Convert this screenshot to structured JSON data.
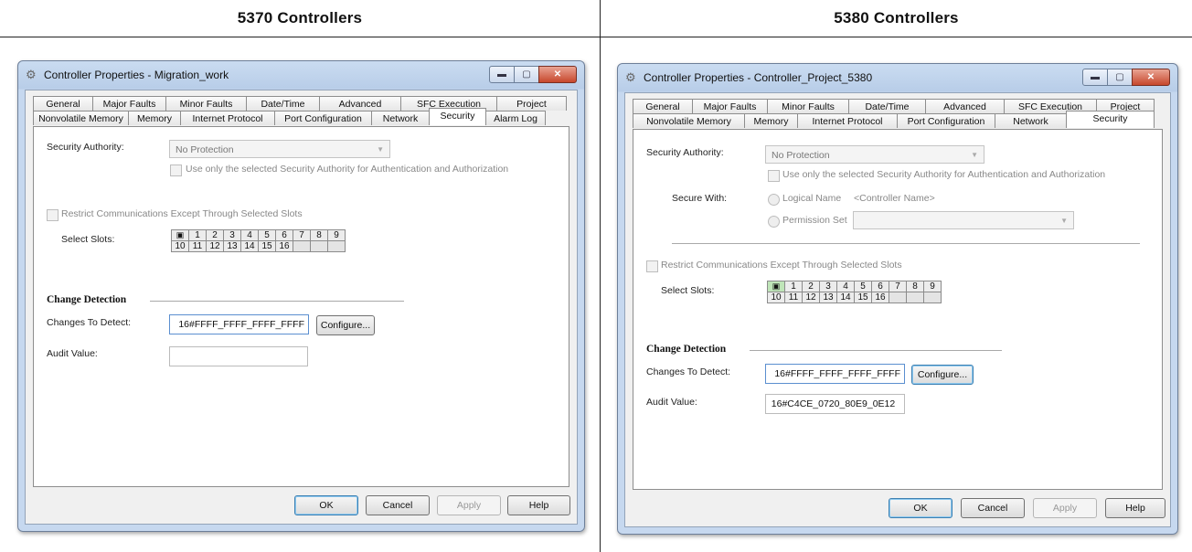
{
  "headers": {
    "left": "5370 Controllers",
    "right": "5380 Controllers"
  },
  "left_dialog": {
    "title": "Controller Properties - Migration_work",
    "tabs_row1": [
      "General",
      "Major Faults",
      "Minor Faults",
      "Date/Time",
      "Advanced",
      "SFC Execution",
      "Project"
    ],
    "tabs_row2": [
      "Nonvolatile Memory",
      "Memory",
      "Internet Protocol",
      "Port Configuration",
      "Network",
      "Security",
      "Alarm Log"
    ],
    "active_tab": "Security",
    "security_authority_label": "Security Authority:",
    "security_authority_value": "No Protection",
    "use_only_label": "Use only the selected Security Authority for Authentication and Authorization",
    "restrict_label": "Restrict Communications Except Through Selected Slots",
    "select_slots_label": "Select Slots:",
    "slots_row1": [
      "1",
      "2",
      "3",
      "4",
      "5",
      "6",
      "7",
      "8",
      "9"
    ],
    "slots_row2": [
      "10",
      "11",
      "12",
      "13",
      "14",
      "15",
      "16",
      "",
      ""
    ],
    "change_detection_label": "Change Detection",
    "changes_to_detect_label": "Changes To Detect:",
    "changes_to_detect_value": "16#FFFF_FFFF_FFFF_FFFF",
    "configure_label": "Configure...",
    "audit_value_label": "Audit Value:",
    "audit_value": "",
    "buttons": {
      "ok": "OK",
      "cancel": "Cancel",
      "apply": "Apply",
      "help": "Help"
    }
  },
  "right_dialog": {
    "title": "Controller Properties - Controller_Project_5380",
    "tabs_row1": [
      "General",
      "Major Faults",
      "Minor Faults",
      "Date/Time",
      "Advanced",
      "SFC Execution",
      "Project"
    ],
    "tabs_row2": [
      "Nonvolatile Memory",
      "Memory",
      "Internet Protocol",
      "Port Configuration",
      "Network",
      "Security"
    ],
    "active_tab": "Security",
    "security_authority_label": "Security Authority:",
    "security_authority_value": "No Protection",
    "use_only_label": "Use only the selected Security Authority for Authentication and Authorization",
    "secure_with_label": "Secure With:",
    "logical_name_label": "Logical Name",
    "logical_name_value": "<Controller Name>",
    "permission_set_label": "Permission Set",
    "restrict_label": "Restrict Communications Except Through Selected Slots",
    "select_slots_label": "Select Slots:",
    "slots_row1": [
      "1",
      "2",
      "3",
      "4",
      "5",
      "6",
      "7",
      "8",
      "9"
    ],
    "slots_row2": [
      "10",
      "11",
      "12",
      "13",
      "14",
      "15",
      "16",
      "",
      ""
    ],
    "change_detection_label": "Change Detection",
    "changes_to_detect_label": "Changes To Detect:",
    "changes_to_detect_value": "16#FFFF_FFFF_FFFF_FFFF",
    "configure_label": "Configure...",
    "audit_value_label": "Audit Value:",
    "audit_value": "16#C4CE_0720_80E9_0E12",
    "buttons": {
      "ok": "OK",
      "cancel": "Cancel",
      "apply": "Apply",
      "help": "Help"
    }
  },
  "icons": {
    "window": "gear-icon",
    "slot": "controller-module-icon",
    "minimize": "minimize-icon",
    "maximize": "maximize-icon",
    "close": "close-icon",
    "dropdown": "chevron-down-icon"
  },
  "colors": {
    "title_bar": "#c4d7ee",
    "close_button": "#c7472c",
    "default_button_border": "#3c7fb1",
    "slot_icon_highlight": "#bfe5b8"
  }
}
